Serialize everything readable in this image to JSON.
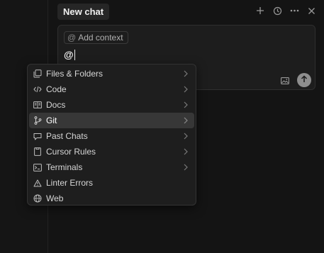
{
  "header": {
    "tab_title": "New chat",
    "icons": [
      "plus-icon",
      "history-icon",
      "more-icon",
      "close-icon"
    ]
  },
  "composer": {
    "add_context_label": "Add context",
    "add_context_prefix": "@",
    "input_value": "@",
    "icons": [
      "image-icon",
      "send-arrow-icon"
    ]
  },
  "menu": {
    "items": [
      {
        "label": "Files & Folders",
        "icon": "files-icon",
        "submenu": true
      },
      {
        "label": "Code",
        "icon": "code-icon",
        "submenu": true
      },
      {
        "label": "Docs",
        "icon": "book-icon",
        "submenu": true
      },
      {
        "label": "Git",
        "icon": "git-branch-icon",
        "submenu": true,
        "active": true
      },
      {
        "label": "Past Chats",
        "icon": "chat-icon",
        "submenu": true
      },
      {
        "label": "Cursor Rules",
        "icon": "rules-icon",
        "submenu": true
      },
      {
        "label": "Terminals",
        "icon": "terminal-icon",
        "submenu": true
      },
      {
        "label": "Linter Errors",
        "icon": "warning-icon",
        "submenu": false
      },
      {
        "label": "Web",
        "icon": "globe-icon",
        "submenu": false
      }
    ]
  },
  "colors": {
    "background": "#141414",
    "menu_bg": "#1e1e1e",
    "active_row": "#373737",
    "send_button": "#8e8e8e"
  }
}
